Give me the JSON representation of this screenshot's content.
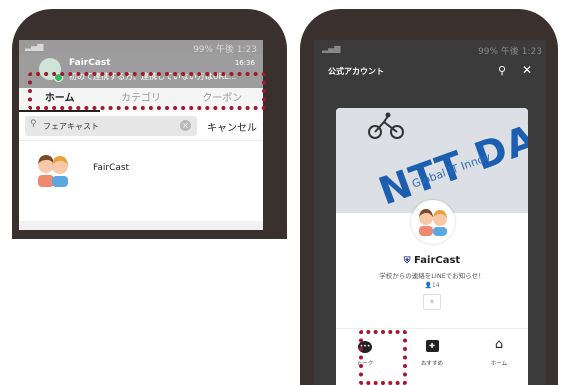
{
  "colors": {
    "highlight": "#a3172f",
    "frame": "#3a302d",
    "online_dot": "#2dbf56"
  },
  "left_screen": {
    "status_bar": {
      "left": "",
      "right": "99% 午後 1:23"
    },
    "notification": {
      "title": "FairCast",
      "time": "16:36",
      "text": "初めて連携する方、連携していない方はURL..."
    },
    "tabs": [
      "ホーム",
      "カテゴリ",
      "クーポン"
    ],
    "search": {
      "value": "フェアキャスト",
      "cancel": "キャンセル"
    },
    "result": {
      "name": "FairCast"
    }
  },
  "right_screen": {
    "status_bar": {
      "right": "99% 午後 1:23"
    },
    "header": {
      "title": "公式アカウント"
    },
    "cover": {
      "brand": "NTT DATA",
      "sub": "Global IT Innov"
    },
    "account": {
      "name": "FairCast",
      "description": "学校からの連絡をLINEでお知らせ！",
      "friends": "14"
    },
    "nav": [
      {
        "label": "トーク",
        "icon": "chat-icon"
      },
      {
        "label": "おすすめ",
        "icon": "recommend-icon"
      },
      {
        "label": "ホーム",
        "icon": "home-icon"
      }
    ]
  }
}
